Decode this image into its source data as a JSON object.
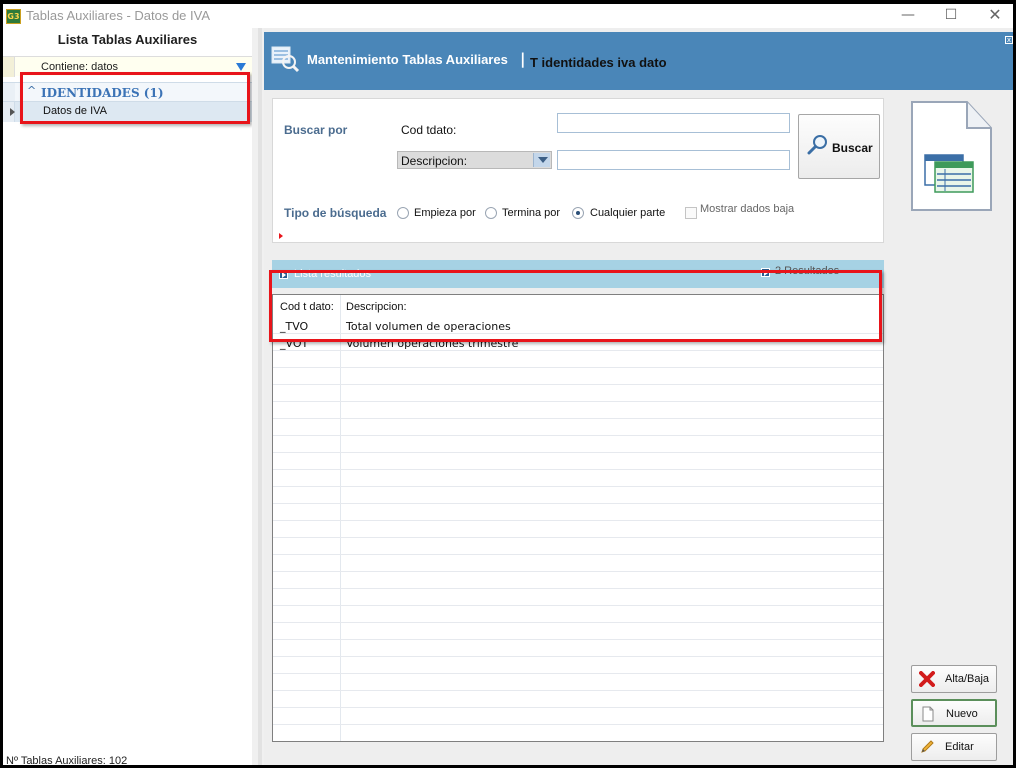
{
  "window": {
    "title": "Tablas Auxiliares - Datos de IVA",
    "app_icon_text": "G3",
    "minimize": "—",
    "maximize": "☐",
    "close": "✕"
  },
  "left_panel": {
    "title": "Lista Tablas Auxiliares",
    "filter": "Contiene: datos",
    "group_label": "IDENTIDADES (1)",
    "group_caret": "^",
    "items": [
      "Datos de IVA"
    ],
    "footer": "Nº Tablas Auxiliares: 102"
  },
  "header": {
    "title": "Mantenimiento Tablas Auxiliares",
    "separator": "|",
    "subtitle": "T identidades iva dato",
    "close": "x"
  },
  "search": {
    "buscar_por_label": "Buscar por",
    "cod_label": "Cod tdato:",
    "cod_value": "",
    "combo_selected": "Descripcion:",
    "desc_value": "",
    "buscar_button": "Buscar",
    "tipo_label": "Tipo de búsqueda",
    "options": [
      "Empieza por",
      "Termina por",
      "Cualquier parte"
    ],
    "selected_option": "Cualquier parte",
    "show_deleted_label": "Mostrar dados baja",
    "show_deleted_checked": false
  },
  "results": {
    "title": "Lista resultados",
    "count": "2 Resultados",
    "columns": [
      "Cod t dato:",
      "Descripcion:"
    ],
    "rows": [
      [
        "_TVO",
        "Total volumen de operaciones"
      ],
      [
        "_VOT",
        "Volumen operaciones trimestre"
      ]
    ],
    "empty_rows": 22
  },
  "actions": {
    "alta_baja": "Alta/Baja",
    "nuevo": "Nuevo",
    "editar": "Editar"
  },
  "colors": {
    "header_blue": "#4a86b8",
    "results_header": "#a6d2e4",
    "annotation_red": "#e8141a"
  }
}
